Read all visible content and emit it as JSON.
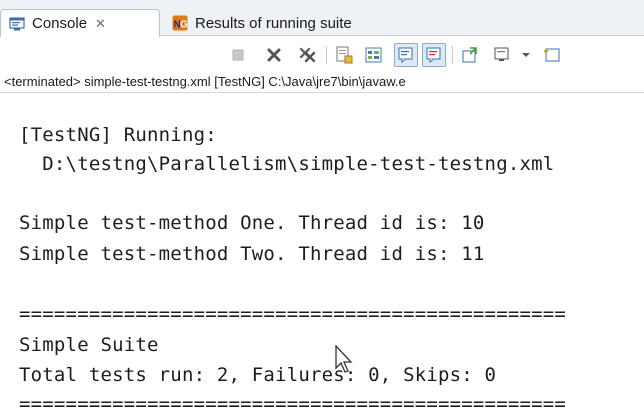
{
  "tabs": [
    {
      "label": "Console",
      "icon": "console-icon",
      "active": true,
      "closable": true
    },
    {
      "label": "Results of running suite",
      "icon": "testng-icon",
      "active": false,
      "closable": false
    }
  ],
  "toolbar": {
    "buttons": [
      {
        "name": "terminate-button",
        "icon": "stop-icon",
        "enabled": false
      },
      {
        "name": "remove-launch-button",
        "icon": "remove-x-icon",
        "enabled": true
      },
      {
        "name": "remove-all-terminated-button",
        "icon": "remove-all-icon",
        "enabled": true
      },
      {
        "name": "scroll-lock-button",
        "icon": "scroll-lock-icon",
        "enabled": true
      },
      {
        "name": "word-wrap-button",
        "icon": "word-wrap-icon",
        "enabled": true
      },
      {
        "name": "show-console-stdout-button",
        "icon": "show-stdout-icon",
        "pressed": true
      },
      {
        "name": "show-console-stderr-button",
        "icon": "show-stderr-icon",
        "pressed": true
      },
      {
        "name": "pin-console-button",
        "icon": "pin-icon",
        "enabled": true
      },
      {
        "name": "display-selected-console-button",
        "icon": "display-console-icon",
        "enabled": true
      },
      {
        "name": "open-console-button",
        "icon": "open-console-icon",
        "enabled": true
      }
    ]
  },
  "process": {
    "status": "<terminated> simple-test-testng.xml [TestNG] C:\\Java\\jre7\\bin\\javaw.e"
  },
  "console": {
    "lines": [
      "[TestNG] Running:",
      "  D:\\testng\\Parallelism\\simple-test-testng.xml",
      "",
      "Simple test-method One. Thread id is: 10",
      "Simple test-method Two. Thread id is: 11",
      "",
      "===============================================",
      "Simple Suite",
      "Total tests run: 2, Failures: 0, Skips: 0",
      "==============================================="
    ]
  },
  "colors": {
    "tabbar_bg": "#eef1f6",
    "text": "#1d1d1d",
    "pressed_bg": "#dfe9f6",
    "pressed_border": "#8fa8c8"
  }
}
